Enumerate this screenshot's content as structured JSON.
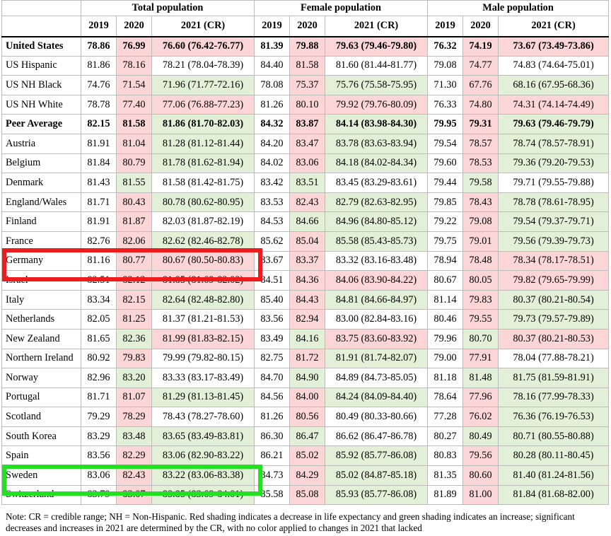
{
  "header": {
    "groups": [
      "Total population",
      "Female population",
      "Male population"
    ],
    "years": [
      "2019",
      "2020",
      "2021 (CR)"
    ]
  },
  "rows": [
    {
      "name": "United States",
      "bold": true,
      "sub": false,
      "t": [
        "78.86",
        "76.99",
        "76.60 (76.42-76.77)"
      ],
      "tc": [
        "",
        "red",
        "red"
      ],
      "f": [
        "81.39",
        "79.88",
        "79.63 (79.46-79.80)"
      ],
      "fc": [
        "",
        "red",
        "red"
      ],
      "m": [
        "76.32",
        "74.19",
        "73.67 (73.49-73.86)"
      ],
      "mc": [
        "",
        "red",
        "red"
      ]
    },
    {
      "name": "US Hispanic",
      "bold": false,
      "sub": true,
      "t": [
        "81.86",
        "78.16",
        "78.21 (78.04-78.39)"
      ],
      "tc": [
        "",
        "red",
        ""
      ],
      "f": [
        "84.40",
        "81.58",
        "81.60 (81.44-81.77)"
      ],
      "fc": [
        "",
        "red",
        ""
      ],
      "m": [
        "79.08",
        "74.77",
        "74.83 (74.64-75.01)"
      ],
      "mc": [
        "",
        "red",
        ""
      ]
    },
    {
      "name": "US NH Black",
      "bold": false,
      "sub": true,
      "t": [
        "74.76",
        "71.54",
        "71.96 (71.77-72.16)"
      ],
      "tc": [
        "",
        "red",
        "green"
      ],
      "f": [
        "78.08",
        "75.37",
        "75.76 (75.58-75.95)"
      ],
      "fc": [
        "",
        "red",
        "green"
      ],
      "m": [
        "71.30",
        "67.76",
        "68.16 (67.95-68.36)"
      ],
      "mc": [
        "",
        "red",
        "green"
      ]
    },
    {
      "name": "US NH White",
      "bold": false,
      "sub": true,
      "t": [
        "78.78",
        "77.40",
        "77.06 (76.88-77.23)"
      ],
      "tc": [
        "",
        "red",
        "red"
      ],
      "f": [
        "81.26",
        "80.10",
        "79.92 (79.76-80.09)"
      ],
      "fc": [
        "",
        "red",
        "red"
      ],
      "m": [
        "76.33",
        "74.80",
        "74.31 (74.14-74.49)"
      ],
      "mc": [
        "",
        "red",
        "red"
      ]
    },
    {
      "name": "Peer Average",
      "bold": true,
      "sub": false,
      "t": [
        "82.15",
        "81.58",
        "81.86 (81.70-82.03)"
      ],
      "tc": [
        "",
        "red",
        "green"
      ],
      "f": [
        "84.32",
        "83.87",
        "84.14 (83.98-84.30)"
      ],
      "fc": [
        "",
        "red",
        "green"
      ],
      "m": [
        "79.95",
        "79.31",
        "79.63 (79.46-79.79)"
      ],
      "mc": [
        "",
        "red",
        "green"
      ]
    },
    {
      "name": "Austria",
      "bold": false,
      "sub": false,
      "t": [
        "81.91",
        "81.04",
        "81.28 (81.12-81.44)"
      ],
      "tc": [
        "",
        "red",
        "green"
      ],
      "f": [
        "84.20",
        "83.47",
        "83.78 (83.63-83.94)"
      ],
      "fc": [
        "",
        "red",
        "green"
      ],
      "m": [
        "79.54",
        "78.57",
        "78.74 (78.57-78.91)"
      ],
      "mc": [
        "",
        "red",
        "green"
      ]
    },
    {
      "name": "Belgium",
      "bold": false,
      "sub": false,
      "t": [
        "81.84",
        "80.79",
        "81.78 (81.62-81.94)"
      ],
      "tc": [
        "",
        "red",
        "green"
      ],
      "f": [
        "84.02",
        "83.06",
        "84.18 (84.02-84.34)"
      ],
      "fc": [
        "",
        "red",
        "green"
      ],
      "m": [
        "79.60",
        "78.53",
        "79.36 (79.20-79.53)"
      ],
      "mc": [
        "",
        "red",
        "green"
      ]
    },
    {
      "name": "Denmark",
      "bold": false,
      "sub": false,
      "t": [
        "81.43",
        "81.55",
        "81.58 (81.42-81.75)"
      ],
      "tc": [
        "",
        "green",
        ""
      ],
      "f": [
        "83.42",
        "83.51",
        "83.45 (83.29-83.61)"
      ],
      "fc": [
        "",
        "green",
        ""
      ],
      "m": [
        "79.44",
        "79.58",
        "79.71 (79.55-79.88)"
      ],
      "mc": [
        "",
        "green",
        ""
      ]
    },
    {
      "name": "England/Wales",
      "bold": false,
      "sub": false,
      "t": [
        "81.71",
        "80.43",
        "80.78 (80.62-80.95)"
      ],
      "tc": [
        "",
        "red",
        "green"
      ],
      "f": [
        "83.53",
        "82.43",
        "82.79 (82.63-82.95)"
      ],
      "fc": [
        "",
        "red",
        "green"
      ],
      "m": [
        "79.85",
        "78.43",
        "78.78 (78.61-78.95)"
      ],
      "mc": [
        "",
        "red",
        "green"
      ]
    },
    {
      "name": "Finland",
      "bold": false,
      "sub": false,
      "t": [
        "81.91",
        "81.87",
        "82.03 (81.87-82.19)"
      ],
      "tc": [
        "",
        "red",
        ""
      ],
      "f": [
        "84.53",
        "84.66",
        "84.96 (84.80-85.12)"
      ],
      "fc": [
        "",
        "green",
        "green"
      ],
      "m": [
        "79.22",
        "79.08",
        "79.54 (79.37-79.71)"
      ],
      "mc": [
        "",
        "red",
        "green"
      ]
    },
    {
      "name": "France",
      "bold": false,
      "sub": false,
      "t": [
        "82.76",
        "82.06",
        "82.62 (82.46-82.78)"
      ],
      "tc": [
        "",
        "red",
        "green"
      ],
      "f": [
        "85.62",
        "85.04",
        "85.58 (85.43-85.73)"
      ],
      "fc": [
        "",
        "red",
        "green"
      ],
      "m": [
        "79.75",
        "79.01",
        "79.56 (79.39-79.73)"
      ],
      "mc": [
        "",
        "red",
        "green"
      ]
    },
    {
      "name": "Germany",
      "bold": false,
      "sub": false,
      "t": [
        "81.16",
        "80.77",
        "80.67 (80.50-80.83)"
      ],
      "tc": [
        "",
        "red",
        "red"
      ],
      "f": [
        "83.67",
        "83.37",
        "83.32 (83.16-83.48)"
      ],
      "fc": [
        "",
        "red",
        ""
      ],
      "m": [
        "78.94",
        "78.48",
        "78.34 (78.17-78.51)"
      ],
      "mc": [
        "",
        "red",
        "red"
      ]
    },
    {
      "name": "Israel",
      "bold": false,
      "sub": false,
      "t": [
        "82.51",
        "82.12",
        "81.85 (81.69-82.02)"
      ],
      "tc": [
        "",
        "red",
        "red"
      ],
      "f": [
        "84.51",
        "84.36",
        "84.06 (83.90-84.22)"
      ],
      "fc": [
        "",
        "red",
        "red"
      ],
      "m": [
        "80.67",
        "80.05",
        "79.82 (79.65-79.99)"
      ],
      "mc": [
        "",
        "red",
        "red"
      ]
    },
    {
      "name": "Italy",
      "bold": false,
      "sub": false,
      "t": [
        "83.34",
        "82.15",
        "82.64 (82.48-82.80)"
      ],
      "tc": [
        "",
        "red",
        "green"
      ],
      "f": [
        "85.40",
        "84.43",
        "84.81 (84.66-84.97)"
      ],
      "fc": [
        "",
        "red",
        "green"
      ],
      "m": [
        "81.14",
        "79.83",
        "80.37 (80.21-80.54)"
      ],
      "mc": [
        "",
        "red",
        "green"
      ]
    },
    {
      "name": "Netherlands",
      "bold": false,
      "sub": false,
      "t": [
        "82.05",
        "81.25",
        "81.37 (81.21-81.53)"
      ],
      "tc": [
        "",
        "red",
        ""
      ],
      "f": [
        "83.56",
        "82.94",
        "83.00 (82.84-83.16)"
      ],
      "fc": [
        "",
        "red",
        ""
      ],
      "m": [
        "80.46",
        "79.55",
        "79.73 (79.57-79.89)"
      ],
      "mc": [
        "",
        "red",
        "green"
      ]
    },
    {
      "name": "New Zealand",
      "bold": false,
      "sub": false,
      "t": [
        "81.65",
        "82.36",
        "81.99 (81.83-82.15)"
      ],
      "tc": [
        "",
        "green",
        "red"
      ],
      "f": [
        "83.49",
        "84.16",
        "83.75 (83.60-83.92)"
      ],
      "fc": [
        "",
        "green",
        "red"
      ],
      "m": [
        "79.96",
        "80.70",
        "80.37 (80.21-80.53)"
      ],
      "mc": [
        "",
        "green",
        "red"
      ]
    },
    {
      "name": "Northern Ireland",
      "bold": false,
      "sub": false,
      "t": [
        "80.92",
        "79.83",
        "79.99 (79.82-80.15)"
      ],
      "tc": [
        "",
        "red",
        ""
      ],
      "f": [
        "82.75",
        "81.72",
        "81.91 (81.74-82.07)"
      ],
      "fc": [
        "",
        "red",
        "green"
      ],
      "m": [
        "79.00",
        "77.91",
        "78.04 (77.88-78.21)"
      ],
      "mc": [
        "",
        "red",
        ""
      ]
    },
    {
      "name": "Norway",
      "bold": false,
      "sub": false,
      "t": [
        "82.96",
        "83.20",
        "83.33 (83.17-83.49)"
      ],
      "tc": [
        "",
        "green",
        ""
      ],
      "f": [
        "84.70",
        "84.90",
        "84.89 (84.73-85.05)"
      ],
      "fc": [
        "",
        "green",
        ""
      ],
      "m": [
        "81.18",
        "81.48",
        "81.75 (81.59-81.91)"
      ],
      "mc": [
        "",
        "green",
        "green"
      ]
    },
    {
      "name": "Portugal",
      "bold": false,
      "sub": false,
      "t": [
        "81.71",
        "81.07",
        "81.29 (81.13-81.45)"
      ],
      "tc": [
        "",
        "red",
        "green"
      ],
      "f": [
        "84.56",
        "84.00",
        "84.24 (84.09-84.40)"
      ],
      "fc": [
        "",
        "red",
        "green"
      ],
      "m": [
        "78.64",
        "77.96",
        "78.16 (77.99-78.33)"
      ],
      "mc": [
        "",
        "red",
        "green"
      ]
    },
    {
      "name": "Scotland",
      "bold": false,
      "sub": false,
      "t": [
        "79.29",
        "78.29",
        "78.43 (78.27-78.60)"
      ],
      "tc": [
        "",
        "red",
        ""
      ],
      "f": [
        "81.26",
        "80.56",
        "80.49 (80.33-80.66)"
      ],
      "fc": [
        "",
        "red",
        ""
      ],
      "m": [
        "77.28",
        "76.02",
        "76.36 (76.19-76.53)"
      ],
      "mc": [
        "",
        "red",
        "green"
      ]
    },
    {
      "name": "South Korea",
      "bold": false,
      "sub": false,
      "t": [
        "83.29",
        "83.48",
        "83.65 (83.49-83.81)"
      ],
      "tc": [
        "",
        "green",
        "green"
      ],
      "f": [
        "86.30",
        "86.47",
        "86.62 (86.47-86.78)"
      ],
      "fc": [
        "",
        "green",
        ""
      ],
      "m": [
        "80.27",
        "80.49",
        "80.71 (80.55-80.88)"
      ],
      "mc": [
        "",
        "green",
        "green"
      ]
    },
    {
      "name": "Spain",
      "bold": false,
      "sub": false,
      "t": [
        "83.56",
        "82.29",
        "83.06 (82.90-83.22)"
      ],
      "tc": [
        "",
        "red",
        "green"
      ],
      "f": [
        "86.21",
        "85.02",
        "85.92 (85.77-86.08)"
      ],
      "fc": [
        "",
        "red",
        "green"
      ],
      "m": [
        "80.83",
        "79.56",
        "80.28 (80.11-80.45)"
      ],
      "mc": [
        "",
        "red",
        "green"
      ]
    },
    {
      "name": "Sweden",
      "bold": false,
      "sub": false,
      "t": [
        "83.06",
        "82.43",
        "83.22 (83.06-83.38)"
      ],
      "tc": [
        "",
        "red",
        "green"
      ],
      "f": [
        "84.73",
        "84.29",
        "85.02 (84.87-85.18)"
      ],
      "fc": [
        "",
        "red",
        "green"
      ],
      "m": [
        "81.35",
        "80.60",
        "81.40 (81.24-81.56)"
      ],
      "mc": [
        "",
        "red",
        "green"
      ]
    },
    {
      "name": "Switzerland",
      "bold": false,
      "sub": false,
      "t": [
        "83.79",
        "83.07",
        "83.85 (83.69-84.01)"
      ],
      "tc": [
        "",
        "red",
        "green"
      ],
      "f": [
        "85.58",
        "85.08",
        "85.93 (85.77-86.08)"
      ],
      "fc": [
        "",
        "red",
        "green"
      ],
      "m": [
        "81.89",
        "81.00",
        "81.84 (81.68-82.00)"
      ],
      "mc": [
        "",
        "red",
        "green"
      ]
    }
  ],
  "note": "Note: CR = credible range; NH = Non-Hispanic. Red shading indicates a decrease in life expectancy and green shading indicates an increase; significant decreases and increases in 2021 are determined by the CR, with no color applied to changes in 2021 that lacked",
  "colors": {
    "decrease": "#fcd6d6",
    "increase": "#e3f0d8",
    "highlight_red": "#ee1c1c",
    "highlight_green": "#22e022"
  }
}
